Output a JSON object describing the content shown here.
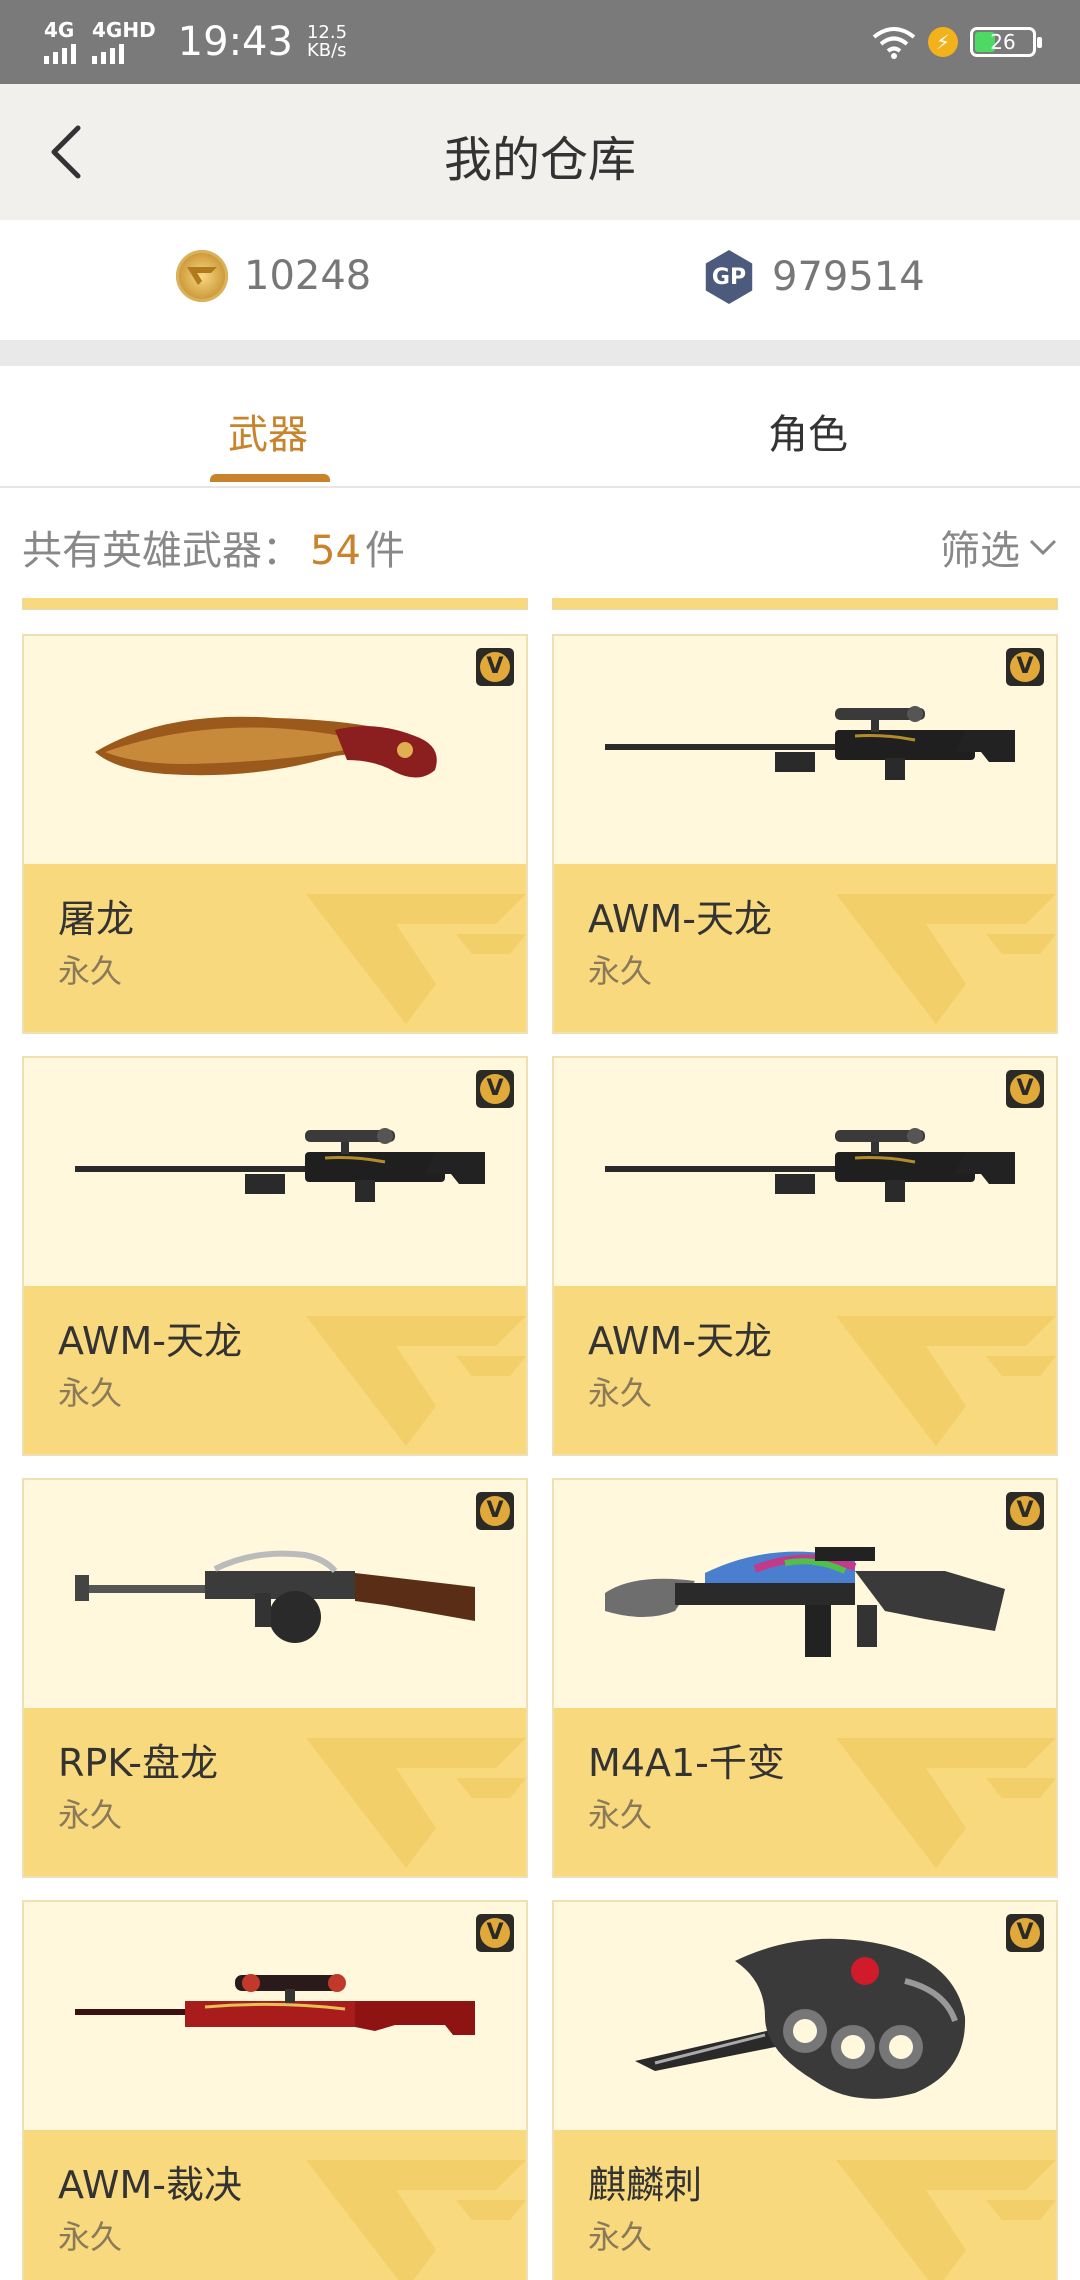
{
  "status_bar": {
    "network_1": "4G",
    "network_2": "4GHD",
    "time": "19:43",
    "speed_value": "12.5",
    "speed_unit": "KB/s",
    "battery": "26",
    "icons": [
      "signal-icon",
      "wifi-icon",
      "charging-icon",
      "battery-icon"
    ]
  },
  "header": {
    "title": "我的仓库",
    "back_icon": "chevron-left-icon"
  },
  "currency": {
    "cf_points": "10248",
    "gp_points": "979514",
    "gp_badge": "GP"
  },
  "tabs": [
    {
      "label": "武器",
      "active": true
    },
    {
      "label": "角色",
      "active": false
    }
  ],
  "summary": {
    "label": "共有英雄武器：",
    "count": "54",
    "unit": "件",
    "filter_label": "筛选"
  },
  "weapons": [
    {
      "name": "屠龙",
      "duration": "永久",
      "art": "knife"
    },
    {
      "name": "AWM-天龙",
      "duration": "永久",
      "art": "sniper-dark"
    },
    {
      "name": "AWM-天龙",
      "duration": "永久",
      "art": "sniper-dark"
    },
    {
      "name": "AWM-天龙",
      "duration": "永久",
      "art": "sniper-dark"
    },
    {
      "name": "RPK-盘龙",
      "duration": "永久",
      "art": "rpk"
    },
    {
      "name": "M4A1-千变",
      "duration": "永久",
      "art": "m4a1"
    },
    {
      "name": "AWM-裁决",
      "duration": "永久",
      "art": "sniper-red"
    },
    {
      "name": "麒麟刺",
      "duration": "永久",
      "art": "knuckle"
    }
  ],
  "badge_letter": "V",
  "colors": {
    "accent": "#c8832b",
    "card_band": "#f8d97e",
    "card_art_bg": "#fff8dc"
  }
}
